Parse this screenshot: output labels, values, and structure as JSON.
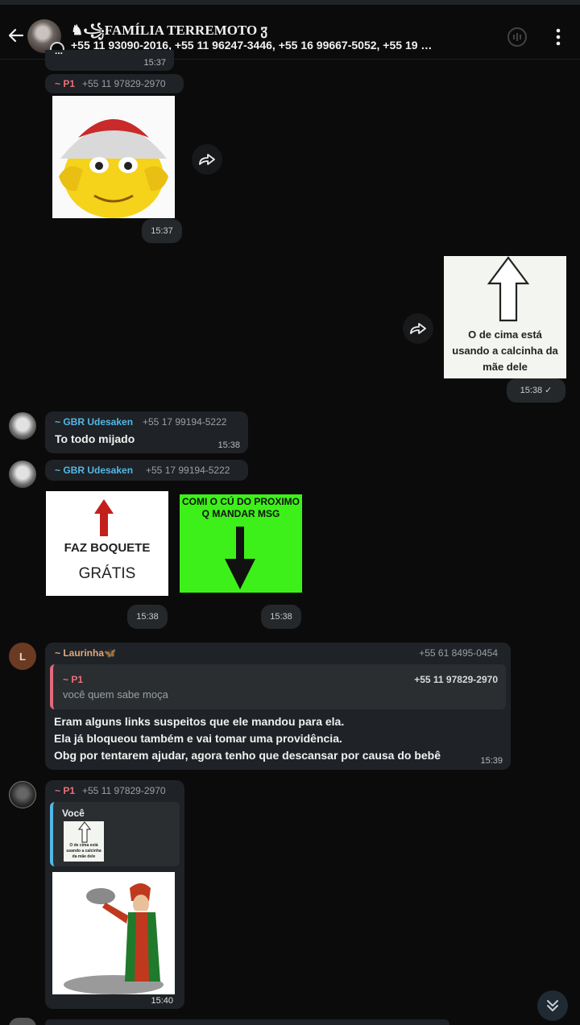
{
  "header": {
    "title": "♞꧁FAMÍLIA TERREMOTO ჳ",
    "participants": "+55 11 93090-2016, +55 11 96247-3446, +55 16 99667-5052, +55 19 …"
  },
  "messages": {
    "m0": {
      "partial_text": "...",
      "time": "15:37"
    },
    "m1": {
      "sender": "~ P1",
      "phone": "+55 11 97829-2970",
      "time": "15:37"
    },
    "m2": {
      "image_text": "O de cima está usando a calcinha da mãe dele",
      "time": "15:38 ✓"
    },
    "m3": {
      "sender": "~ GBR Udesaken",
      "phone": "+55 17 99194-5222",
      "text": "To todo mijado",
      "time": "15:38"
    },
    "m4": {
      "sender": "~ GBR Udesaken",
      "phone": "+55 17 99194-5222",
      "sticker1_line1": "FAZ BOQUETE",
      "sticker1_line2": "GRÁTIS",
      "time1": "15:38",
      "sticker2_line1": "COMI O CÚ DO PROXIMO",
      "sticker2_line2": "Q MANDAR MSG",
      "time2": "15:38"
    },
    "m5": {
      "avatar_letter": "L",
      "sender": "~ Laurinha🦋",
      "phone": "+55 61 8495-0454",
      "quote_sender": "~ P1",
      "quote_phone": "+55 11 97829-2970",
      "quote_text": "você quem sabe moça",
      "line1": "Eram alguns links suspeitos que ele mandou para ela.",
      "line2": "Ela já bloqueou também e vai tomar uma providência.",
      "line3": "Obg por tentarem ajudar, agora tenho que descansar por causa do bebê",
      "time": "15:39"
    },
    "m6": {
      "sender": "~ P1",
      "phone": "+55 11 97829-2970",
      "quote_sender": "Você",
      "quote_thumb_text": "O de cima está usando a calcinha da mãe dele",
      "time": "15:40"
    }
  },
  "colors": {
    "p1": "#e8707a",
    "gbr": "#53b8e8",
    "laurinha": "#e0a97c",
    "bubble": "#1f2226",
    "background": "#0b0b0b"
  }
}
